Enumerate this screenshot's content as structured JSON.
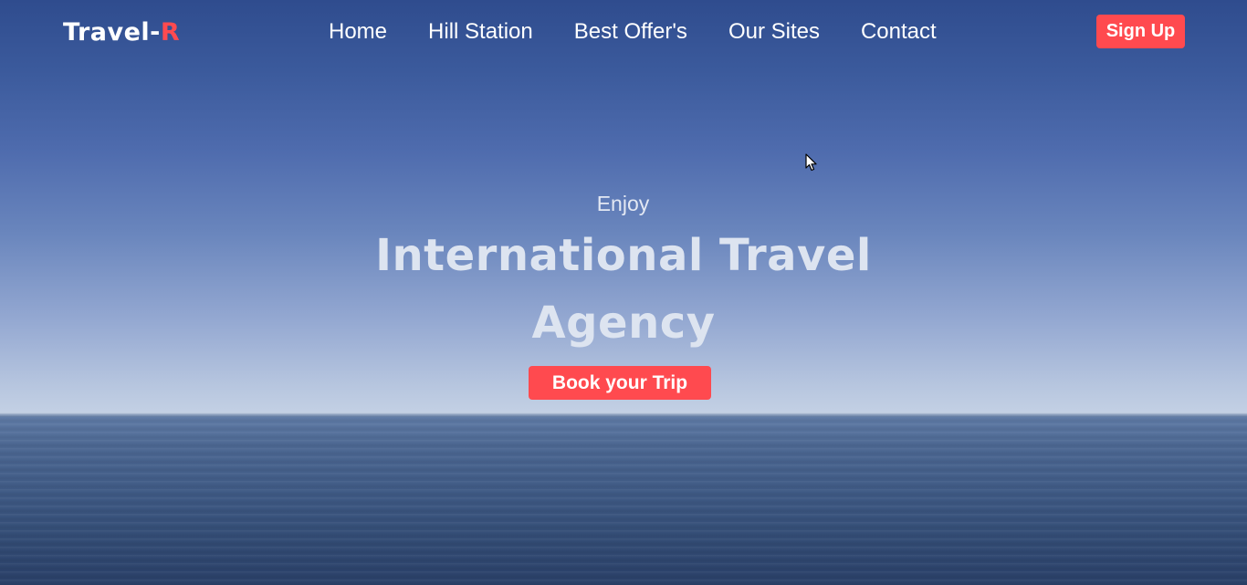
{
  "brand": {
    "name_main": "Travel-",
    "name_accent": "R"
  },
  "nav": {
    "items": [
      {
        "label": "Home"
      },
      {
        "label": "Hill Station"
      },
      {
        "label": "Best Offer's"
      },
      {
        "label": "Our Sites"
      },
      {
        "label": "Contact"
      }
    ],
    "signup_label": "Sign Up"
  },
  "hero": {
    "eyebrow": "Enjoy",
    "headline": "International Travel Agency",
    "cta_label": "Book your Trip"
  },
  "colors": {
    "accent": "#ff4a4f",
    "text_light": "#ffffff"
  },
  "icons": {
    "cursor": "mouse-pointer-icon"
  }
}
